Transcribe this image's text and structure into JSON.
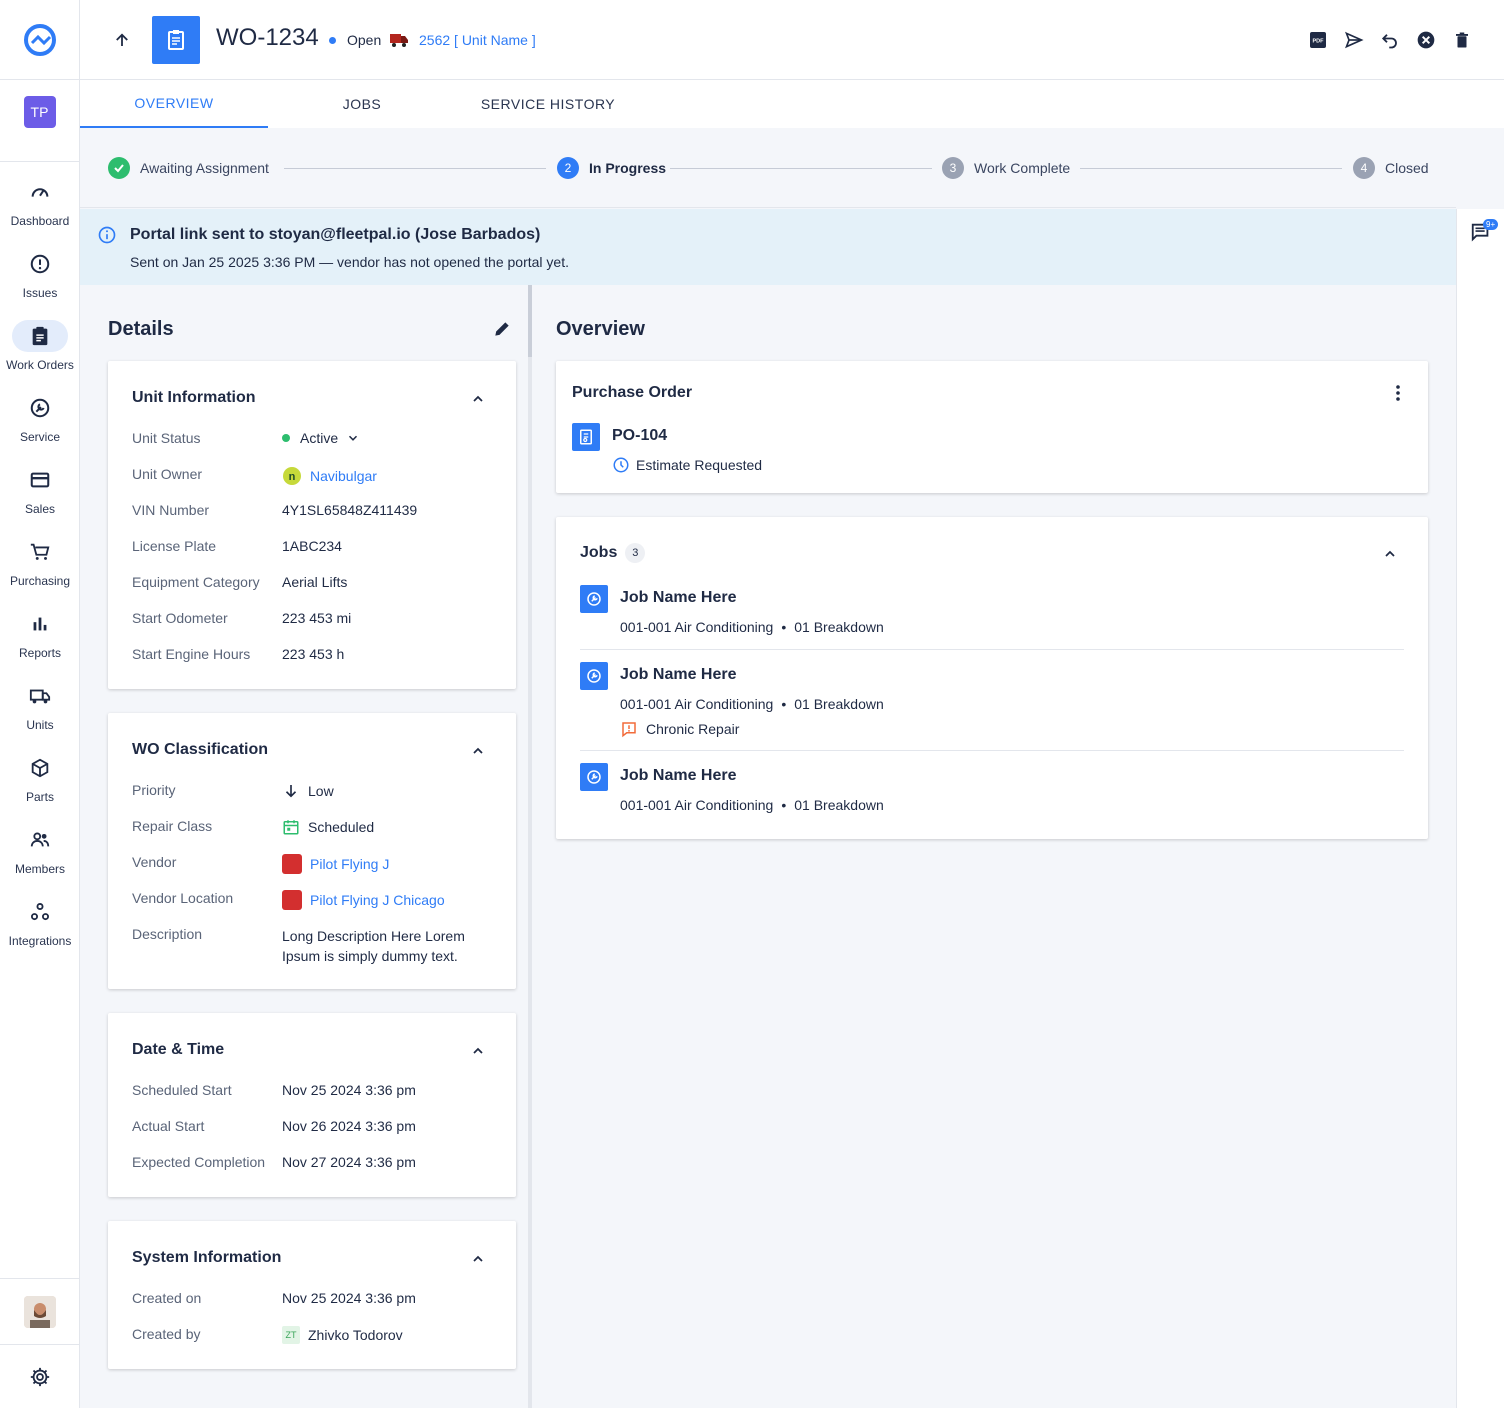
{
  "header": {
    "wo_number": "WO-1234",
    "status": "Open",
    "unit_link": "2562 [ Unit Name ]",
    "actions": [
      "pdf-icon",
      "send-icon",
      "undo-icon",
      "cancel-icon",
      "delete-icon"
    ]
  },
  "sidebar": {
    "badge": "TP",
    "items": [
      {
        "label": "Dashboard",
        "icon": "dashboard-icon"
      },
      {
        "label": "Issues",
        "icon": "alert-circle-icon"
      },
      {
        "label": "Work Orders",
        "icon": "clipboard-icon"
      },
      {
        "label": "Service",
        "icon": "wrench-icon"
      },
      {
        "label": "Sales",
        "icon": "credit-card-icon"
      },
      {
        "label": "Purchasing",
        "icon": "cart-icon"
      },
      {
        "label": "Reports",
        "icon": "bar-chart-icon"
      },
      {
        "label": "Units",
        "icon": "truck-icon"
      },
      {
        "label": "Parts",
        "icon": "cube-icon"
      },
      {
        "label": "Members",
        "icon": "people-icon"
      },
      {
        "label": "Integrations",
        "icon": "integrations-icon"
      }
    ]
  },
  "tabs": [
    "OVERVIEW",
    "JOBS",
    "SERVICE HISTORY"
  ],
  "stepper": {
    "steps": [
      {
        "num": "",
        "label": "Awaiting Assignment",
        "state": "done"
      },
      {
        "num": "2",
        "label": "In Progress",
        "state": "current"
      },
      {
        "num": "3",
        "label": "Work Complete",
        "state": "pending"
      },
      {
        "num": "4",
        "label": "Closed",
        "state": "pending"
      }
    ]
  },
  "banner": {
    "title": "Portal link sent to stoyan@fleetpal.io (Jose Barbados)",
    "subtitle": "Sent on Jan 25 2025 3:36 PM — vendor has not opened the portal yet."
  },
  "rail": {
    "badge": "9+"
  },
  "details": {
    "title": "Details",
    "unit_info": {
      "title": "Unit Information",
      "unit_status_label": "Unit Status",
      "unit_status": "Active",
      "unit_owner_label": "Unit Owner",
      "unit_owner": "Navibulgar",
      "vin_label": "VIN Number",
      "vin": "4Y1SL65848Z411439",
      "plate_label": "License Plate",
      "plate": "1ABC234",
      "category_label": "Equipment Category",
      "category": "Aerial Lifts",
      "odometer_label": "Start Odometer",
      "odometer": "223 453 mi",
      "engine_label": "Start Engine Hours",
      "engine": "223 453 h"
    },
    "classification": {
      "title": "WO Classification",
      "priority_label": "Priority",
      "priority": "Low",
      "repair_label": "Repair Class",
      "repair": "Scheduled",
      "vendor_label": "Vendor",
      "vendor": "Pilot Flying J",
      "vendor_loc_label": "Vendor Location",
      "vendor_loc": "Pilot Flying J Chicago",
      "desc_label": "Description",
      "desc_line1": "Long Description Here Lorem",
      "desc_line2": "Ipsum is simply dummy text."
    },
    "datetime": {
      "title": "Date & Time",
      "sched_label": "Scheduled Start",
      "sched": "Nov 25 2024 3:36 pm",
      "actual_label": "Actual Start",
      "actual": "Nov 26 2024 3:36 pm",
      "expected_label": "Expected Completion",
      "expected": "Nov 27 2024 3:36 pm"
    },
    "system": {
      "title": "System Information",
      "created_on_label": "Created on",
      "created_on": "Nov 25 2024 3:36 pm",
      "created_by_label": "Created by",
      "created_by_initials": "ZT",
      "created_by": "Zhivko Todorov"
    }
  },
  "overview": {
    "title": "Overview",
    "po": {
      "title": "Purchase Order",
      "number": "PO-104",
      "status": "Estimate Requested"
    },
    "jobs": {
      "title": "Jobs",
      "count": "3",
      "items": [
        {
          "name": "Job Name Here",
          "code": "001-001 Air Conditioning",
          "type": "01 Breakdown",
          "extra": ""
        },
        {
          "name": "Job Name Here",
          "code": "001-001 Air Conditioning",
          "type": "01 Breakdown",
          "extra": "Chronic Repair"
        },
        {
          "name": "Job Name Here",
          "code": "001-001 Air Conditioning",
          "type": "01 Breakdown",
          "extra": ""
        }
      ]
    }
  },
  "colors": {
    "accent": "#2f7cf6",
    "success": "#2dbd6e",
    "banner": "#e4f1f9",
    "pilot_red": "#d32f2f",
    "chronic": "#f26b3a"
  }
}
